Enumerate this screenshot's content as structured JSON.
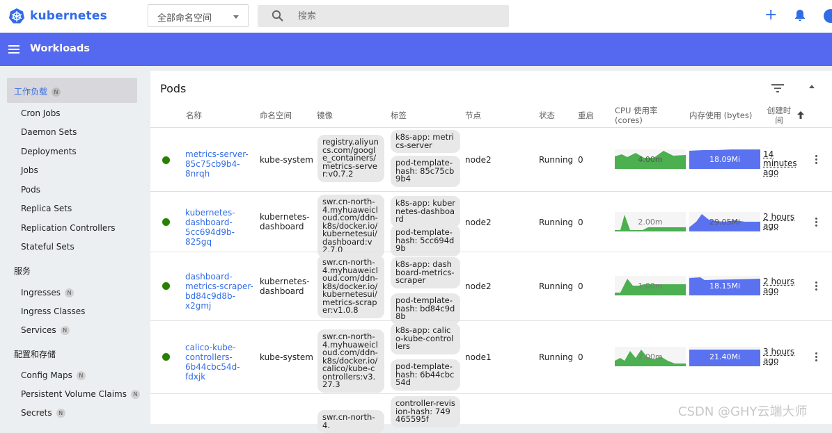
{
  "app": {
    "name": "kubernetes"
  },
  "topbar": {
    "namespace_selected": "全部命名空间",
    "search_placeholder": "搜索"
  },
  "bluebar": {
    "title": "Workloads"
  },
  "sidebar": {
    "active": {
      "label": "工作负载",
      "badge": "N"
    },
    "workloads": [
      "Cron Jobs",
      "Daemon Sets",
      "Deployments",
      "Jobs",
      "Pods",
      "Replica Sets",
      "Replication Controllers",
      "Stateful Sets"
    ],
    "services_head": "服务",
    "services": [
      {
        "label": "Ingresses",
        "badge": "N"
      },
      {
        "label": "Ingress Classes",
        "badge": ""
      },
      {
        "label": "Services",
        "badge": "N"
      }
    ],
    "config_head": "配置和存储",
    "config": [
      {
        "label": "Config Maps",
        "badge": "N"
      },
      {
        "label": "Persistent Volume Claims",
        "badge": "N"
      },
      {
        "label": "Secrets",
        "badge": "N"
      }
    ]
  },
  "card": {
    "title": "Pods"
  },
  "columns": {
    "name": "名称",
    "namespace": "命名空间",
    "image": "镜像",
    "labels": "标签",
    "node": "节点",
    "status": "状态",
    "restarts": "重启",
    "cpu": "CPU 使用率 (cores)",
    "memory": "内存使用 (bytes)",
    "created": "创建时间"
  },
  "rows": [
    {
      "name": "metrics-server-85c75cb9b4-8nrqh",
      "namespace": "kube-system",
      "image": "registry.aliyuncs.com/google_containers/metrics-server:v0.7.2",
      "labels": [
        "k8s-app: metrics-server",
        "pod-template-hash: 85c75cb9b4"
      ],
      "node": "node2",
      "status": "Running",
      "restarts": "0",
      "cpu": "4.00m",
      "memory": "18.09Mi",
      "created": "14 minutes ago"
    },
    {
      "name": "kubernetes-dashboard-5cc694d9b-825gq",
      "namespace": "kubernetes-dashboard",
      "image": "swr.cn-north-4.myhuaweicloud.com/ddn-k8s/docker.io/kubernetesui/dashboard:v2.7.0",
      "labels": [
        "k8s-app: kubernetes-dashboard",
        "pod-template-hash: 5cc694d9b"
      ],
      "node": "node2",
      "status": "Running",
      "restarts": "0",
      "cpu": "2.00m",
      "memory": "29.05Mi",
      "created": "2 hours ago"
    },
    {
      "name": "dashboard-metrics-scraper-bd84c9d8b-x2gmj",
      "namespace": "kubernetes-dashboard",
      "image": "swr.cn-north-4.myhuaweicloud.com/ddn-k8s/docker.io/kubernetesui/metrics-scraper:v1.0.8",
      "labels": [
        "k8s-app: dashboard-metrics-scraper",
        "pod-template-hash: bd84c9d8b"
      ],
      "node": "node2",
      "status": "Running",
      "restarts": "0",
      "cpu": "1.00m",
      "memory": "18.15Mi",
      "created": "2 hours ago"
    },
    {
      "name": "calico-kube-controllers-6b44cbc54d-fdxjk",
      "namespace": "kube-system",
      "image": "swr.cn-north-4.myhuaweicloud.com/ddn-k8s/docker.io/calico/kube-controllers:v3.27.3",
      "labels": [
        "k8s-app: calico-kube-controllers",
        "pod-template-hash: 6b44cbc54d"
      ],
      "node": "node1",
      "status": "Running",
      "restarts": "0",
      "cpu": "2.00m",
      "memory": "21.40Mi",
      "created": "3 hours ago"
    },
    {
      "name": "",
      "namespace": "",
      "image": "swr.cn-north-4.",
      "labels": [
        "controller-revision-hash: 749465595f"
      ],
      "node": "",
      "status": "",
      "restarts": "",
      "cpu": "",
      "memory": "",
      "created": ""
    }
  ],
  "watermark": "CSDN @GHY云端大师",
  "colors": {
    "accent": "#326ce5",
    "bar": "#5468f0",
    "cpu_fill": "#4caf50",
    "mem_fill": "#5a72f0",
    "running": "#288000"
  }
}
